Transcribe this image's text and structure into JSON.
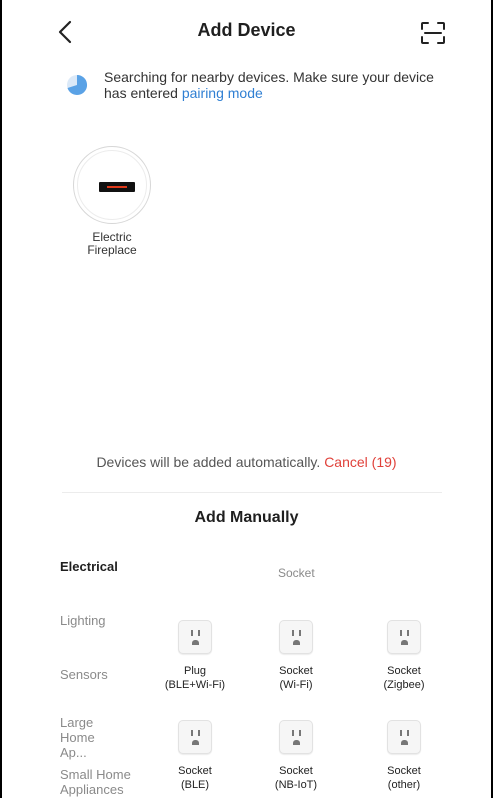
{
  "header": {
    "title": "Add Device",
    "back_icon": "chevron-left-icon",
    "scan_icon": "scan-icon"
  },
  "notice": {
    "text": "Searching for nearby devices. Make sure your device has entered",
    "link": "pairing mode"
  },
  "found_devices": [
    {
      "name": "Electric Fireplace"
    }
  ],
  "auto_add": {
    "text": "Devices will be added automatically.",
    "cancel": "Cancel (19)"
  },
  "manual": {
    "title": "Add Manually",
    "categories": [
      {
        "label": "Electrical",
        "active": true
      },
      {
        "label": "Lighting",
        "active": false
      },
      {
        "label": "Sensors",
        "active": false
      },
      {
        "label": "Large Home Ap...",
        "active": false
      },
      {
        "label": "Small Home Appliances",
        "active": false
      }
    ],
    "section": "Socket",
    "products": [
      {
        "line1": "Plug",
        "line2": "(BLE+Wi-Fi)"
      },
      {
        "line1": "Socket",
        "line2": "(Wi-Fi)"
      },
      {
        "line1": "Socket",
        "line2": "(Zigbee)"
      },
      {
        "line1": "Socket",
        "line2": "(BLE)"
      },
      {
        "line1": "Socket",
        "line2": "(NB-IoT)"
      },
      {
        "line1": "Socket",
        "line2": "(other)"
      }
    ]
  },
  "colors": {
    "link": "#2f7fd3",
    "cancel": "#e0413a",
    "spinner": "#5aa2e6"
  }
}
